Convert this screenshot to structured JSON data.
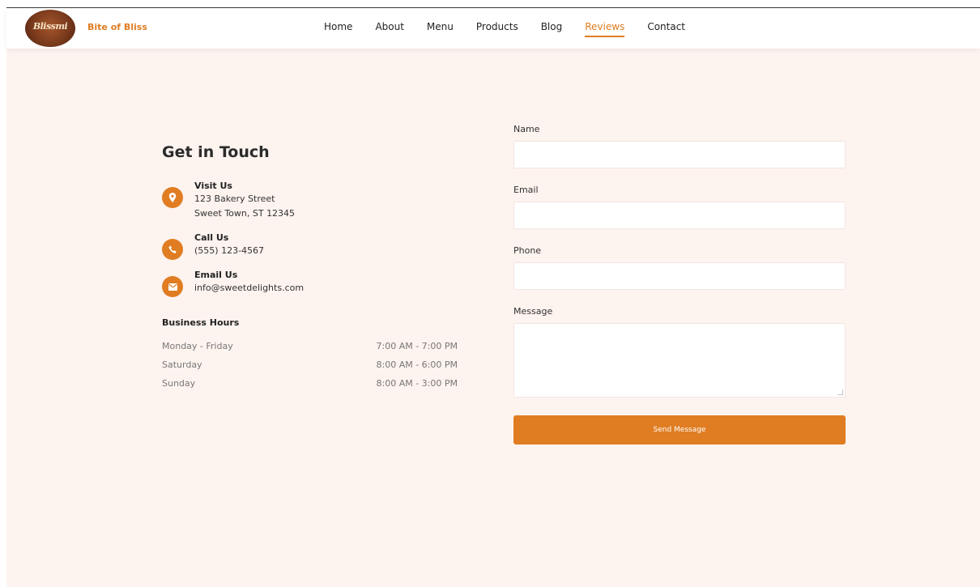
{
  "header": {
    "logo_text": "Blissmi",
    "brand": "Bite of Bliss",
    "nav": [
      "Home",
      "About",
      "Menu",
      "Products",
      "Blog",
      "Reviews",
      "Contact"
    ],
    "active_nav": "Reviews"
  },
  "contact": {
    "title": "Get in Touch",
    "visit": {
      "heading": "Visit Us",
      "line1": "123 Bakery Street",
      "line2": "Sweet Town, ST 12345",
      "icon": "map-pin-icon"
    },
    "call": {
      "heading": "Call Us",
      "line1": "(555) 123-4567",
      "icon": "phone-icon"
    },
    "email": {
      "heading": "Email Us",
      "line1": "info@sweetdelights.com",
      "icon": "envelope-icon"
    }
  },
  "hours": {
    "title": "Business Hours",
    "rows": [
      {
        "day": "Monday - Friday",
        "time": "7:00 AM - 7:00 PM"
      },
      {
        "day": "Saturday",
        "time": "8:00 AM - 6:00 PM"
      },
      {
        "day": "Sunday",
        "time": "8:00 AM - 3:00 PM"
      }
    ]
  },
  "form": {
    "name_label": "Name",
    "email_label": "Email",
    "phone_label": "Phone",
    "message_label": "Message",
    "submit_label": "Send Message"
  },
  "colors": {
    "accent": "#e07d22",
    "background": "#fdf3ef"
  }
}
